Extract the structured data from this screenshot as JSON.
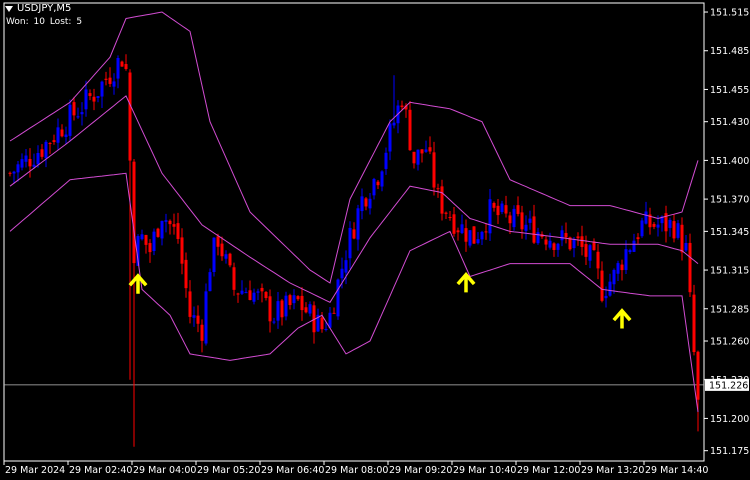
{
  "header": {
    "title": "USDJPY,M5",
    "won_label": "Won:",
    "won_value": "10",
    "lost_label": "Lost:",
    "lost_value": "5"
  },
  "colors": {
    "background": "#000000",
    "bull_candle": "#0000ff",
    "bear_candle": "#ff0000",
    "bands": "#d24cd2",
    "arrow": "#ffff00",
    "current_line": "#c0c0c0",
    "axis": "#ffffff"
  },
  "chart_data": {
    "type": "candlestick",
    "symbol": "USDJPY",
    "timeframe": "M5",
    "y_ticks": [
      151.515,
      151.485,
      151.455,
      151.43,
      151.4,
      151.37,
      151.345,
      151.315,
      151.285,
      151.26,
      151.23,
      151.2,
      151.175
    ],
    "y_tick_labels": [
      "151.515",
      "151.485",
      "151.455",
      "151.430",
      "151.400",
      "151.370",
      "151.345",
      "151.315",
      "151.285",
      "151.260",
      "151.230",
      "151.200",
      "151.175"
    ],
    "ylim": [
      151.167,
      151.522
    ],
    "current_price": 151.226,
    "current_price_label": "151.226",
    "x_labels": [
      "29 Mar 2024",
      "29 Mar 02:40",
      "29 Mar 04:00",
      "29 Mar 05:20",
      "29 Mar 06:40",
      "29 Mar 08:00",
      "29 Mar 09:20",
      "29 Mar 10:40",
      "29 Mar 12:00",
      "29 Mar 13:20",
      "29 Mar 14:40"
    ],
    "bars_count": 173,
    "close_keypoints": [
      [
        0,
        151.39
      ],
      [
        8,
        151.41
      ],
      [
        14,
        151.43
      ],
      [
        22,
        151.455
      ],
      [
        28,
        151.48
      ],
      [
        29,
        151.47
      ],
      [
        30,
        151.4
      ],
      [
        31,
        151.33
      ],
      [
        33,
        151.34
      ],
      [
        35,
        151.33
      ],
      [
        38,
        151.36
      ],
      [
        42,
        151.34
      ],
      [
        45,
        151.28
      ],
      [
        48,
        151.27
      ],
      [
        50,
        151.32
      ],
      [
        52,
        151.34
      ],
      [
        56,
        151.3
      ],
      [
        60,
        151.3
      ],
      [
        66,
        151.28
      ],
      [
        72,
        151.29
      ],
      [
        78,
        151.27
      ],
      [
        80,
        151.28
      ],
      [
        84,
        151.33
      ],
      [
        88,
        151.37
      ],
      [
        92,
        151.39
      ],
      [
        95,
        151.42
      ],
      [
        98,
        151.45
      ],
      [
        101,
        151.4
      ],
      [
        104,
        151.41
      ],
      [
        107,
        151.37
      ],
      [
        112,
        151.35
      ],
      [
        116,
        151.34
      ],
      [
        120,
        151.36
      ],
      [
        128,
        151.35
      ],
      [
        136,
        151.34
      ],
      [
        142,
        151.335
      ],
      [
        146,
        151.32
      ],
      [
        148,
        151.3
      ],
      [
        151,
        151.31
      ],
      [
        154,
        151.33
      ],
      [
        158,
        151.35
      ],
      [
        166,
        151.35
      ],
      [
        169,
        151.33
      ],
      [
        171,
        151.25
      ],
      [
        172,
        151.21
      ]
    ],
    "bollinger_upper_keypoints": [
      [
        0,
        151.415
      ],
      [
        15,
        151.445
      ],
      [
        25,
        151.48
      ],
      [
        29,
        151.51
      ],
      [
        38,
        151.515
      ],
      [
        45,
        151.5
      ],
      [
        50,
        151.43
      ],
      [
        60,
        151.36
      ],
      [
        70,
        151.33
      ],
      [
        75,
        151.315
      ],
      [
        80,
        151.305
      ],
      [
        85,
        151.37
      ],
      [
        95,
        151.43
      ],
      [
        100,
        151.445
      ],
      [
        110,
        151.44
      ],
      [
        118,
        151.43
      ],
      [
        125,
        151.385
      ],
      [
        140,
        151.365
      ],
      [
        150,
        151.365
      ],
      [
        162,
        151.355
      ],
      [
        168,
        151.36
      ],
      [
        172,
        151.4
      ]
    ],
    "bollinger_middle_keypoints": [
      [
        0,
        151.38
      ],
      [
        15,
        151.415
      ],
      [
        29,
        151.45
      ],
      [
        38,
        151.39
      ],
      [
        48,
        151.35
      ],
      [
        60,
        151.325
      ],
      [
        70,
        151.305
      ],
      [
        80,
        151.29
      ],
      [
        90,
        151.34
      ],
      [
        100,
        151.38
      ],
      [
        108,
        151.375
      ],
      [
        115,
        151.355
      ],
      [
        125,
        151.345
      ],
      [
        138,
        151.34
      ],
      [
        150,
        151.335
      ],
      [
        162,
        151.335
      ],
      [
        168,
        151.33
      ],
      [
        172,
        151.32
      ]
    ],
    "bollinger_lower_keypoints": [
      [
        0,
        151.345
      ],
      [
        15,
        151.385
      ],
      [
        29,
        151.39
      ],
      [
        33,
        151.3
      ],
      [
        40,
        151.28
      ],
      [
        45,
        151.25
      ],
      [
        55,
        151.245
      ],
      [
        65,
        151.25
      ],
      [
        72,
        151.27
      ],
      [
        78,
        151.28
      ],
      [
        84,
        151.25
      ],
      [
        90,
        151.26
      ],
      [
        100,
        151.33
      ],
      [
        110,
        151.345
      ],
      [
        115,
        151.31
      ],
      [
        125,
        151.32
      ],
      [
        140,
        151.32
      ],
      [
        148,
        151.3
      ],
      [
        160,
        151.295
      ],
      [
        168,
        151.295
      ],
      [
        170,
        151.25
      ],
      [
        172,
        151.205
      ]
    ],
    "signal_arrows": [
      {
        "bar": 32,
        "price": 151.305,
        "direction": "up"
      },
      {
        "bar": 114,
        "price": 151.306,
        "direction": "up"
      },
      {
        "bar": 153,
        "price": 151.278,
        "direction": "up"
      }
    ]
  }
}
